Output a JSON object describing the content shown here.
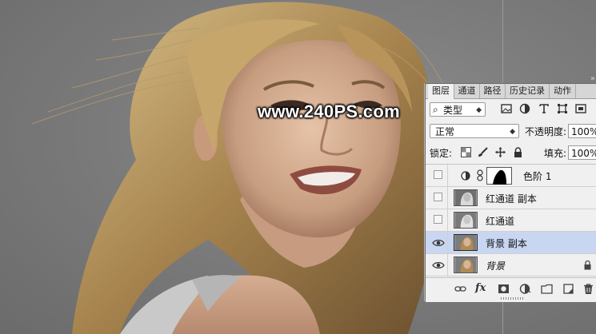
{
  "watermark": "www.240PS.com",
  "panel": {
    "collapse_marker": "»",
    "tabs": [
      {
        "label": "图层",
        "active": true
      },
      {
        "label": "通道",
        "active": false
      },
      {
        "label": "路径",
        "active": false
      },
      {
        "label": "历史记录",
        "active": false
      },
      {
        "label": "动作",
        "active": false
      }
    ],
    "filter": {
      "search_glyph": "⌕",
      "kind": "类型",
      "caret": "◆"
    },
    "blend_mode": "正常",
    "opacity_label": "不透明度:",
    "opacity_value": "100%",
    "lock_label": "锁定:",
    "fill_label": "填充:",
    "fill_value": "100%",
    "filter_icons": [
      "image-filter-icon",
      "adjustment-filter-icon",
      "type-filter-icon",
      "shape-filter-icon",
      "smart-object-filter-icon"
    ],
    "lock_icons": [
      "lock-transparent-icon",
      "lock-image-icon",
      "lock-position-icon",
      "lock-all-icon"
    ],
    "layers": [
      {
        "name": "色阶 1",
        "visible": false,
        "selected": false,
        "kind": "adjustment"
      },
      {
        "name": "红通道 副本",
        "visible": false,
        "selected": false,
        "kind": "image-bw"
      },
      {
        "name": "红通道",
        "visible": false,
        "selected": false,
        "kind": "image-bw"
      },
      {
        "name": "背景 副本",
        "visible": true,
        "selected": true,
        "kind": "image-color"
      },
      {
        "name": "背景",
        "visible": true,
        "selected": false,
        "kind": "image-color",
        "locked": true
      }
    ],
    "footer": {
      "fx_label": "fx",
      "icons": [
        "link-layers-icon",
        "layer-style-icon",
        "add-mask-icon",
        "new-adjustment-icon",
        "new-group-icon",
        "new-layer-icon",
        "delete-layer-icon"
      ]
    },
    "selection_color": "#c9d6f2"
  }
}
